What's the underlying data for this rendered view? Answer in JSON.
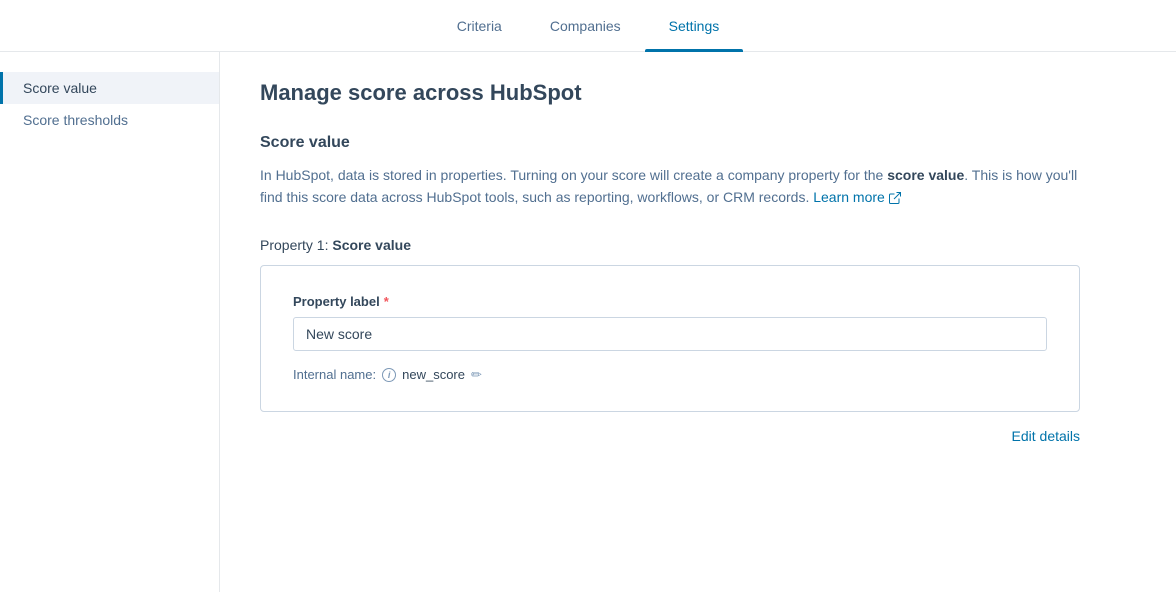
{
  "nav": {
    "tabs": [
      {
        "id": "criteria",
        "label": "Criteria",
        "active": false
      },
      {
        "id": "companies",
        "label": "Companies",
        "active": false
      },
      {
        "id": "settings",
        "label": "Settings",
        "active": true
      }
    ]
  },
  "sidebar": {
    "items": [
      {
        "id": "score-value",
        "label": "Score value",
        "active": true
      },
      {
        "id": "score-thresholds",
        "label": "Score thresholds",
        "active": false
      }
    ]
  },
  "main": {
    "page_title": "Manage score across HubSpot",
    "section_title": "Score value",
    "description_part1": "In HubSpot, data is stored in properties. Turning on your score will create a company property for the ",
    "description_bold": "score value",
    "description_part2": ". This is how you'll find this score data across HubSpot tools, such as reporting, workflows, or CRM records.",
    "learn_more_label": "Learn more",
    "property_heading_prefix": "Property 1: ",
    "property_heading_bold": "Score value",
    "property_label_field": "Property label",
    "required_marker": "*",
    "property_label_value": "New score",
    "internal_name_label": "Internal name:",
    "internal_name_value": "new_score",
    "edit_details_label": "Edit details"
  }
}
